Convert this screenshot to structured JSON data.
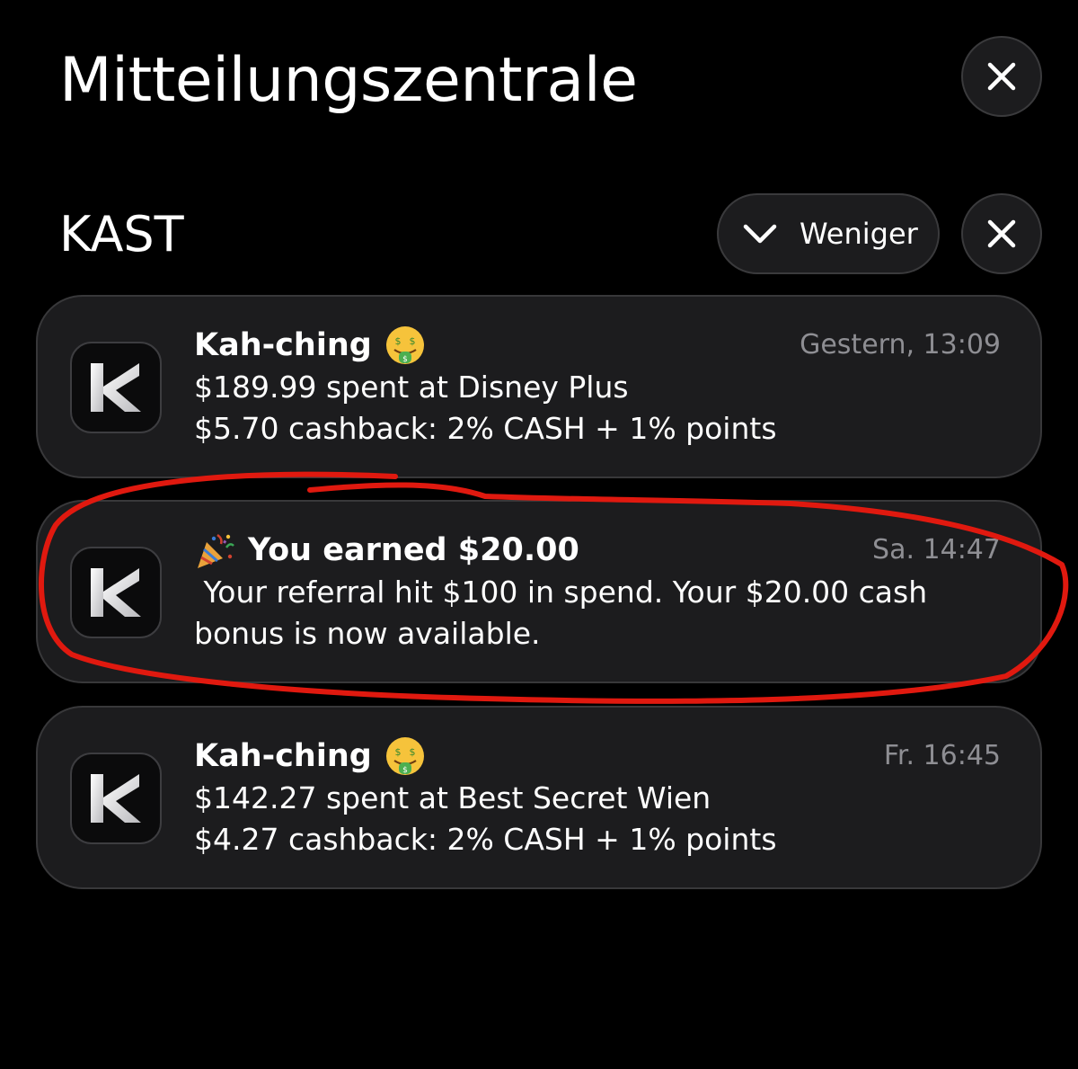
{
  "header": {
    "title": "Mitteilungszentrale"
  },
  "group": {
    "name": "KAST",
    "less_label": "Weniger"
  },
  "notifications": [
    {
      "title": "Kah-ching",
      "emoji": "money-mouth-face-icon",
      "time": "Gestern, 13:09",
      "lines": [
        "$189.99 spent at Disney Plus",
        "$5.70 cashback: 2% CASH + 1% points"
      ]
    },
    {
      "title": "You earned $20.00",
      "emoji": "party-popper-icon",
      "time": "Sa. 14:47",
      "lines": [
        " Your referral hit $100 in spend. Your $20.00 cash",
        "bonus is now available."
      ]
    },
    {
      "title": "Kah-ching",
      "emoji": "money-mouth-face-icon",
      "time": "Fr. 16:45",
      "lines": [
        "$142.27 spent at Best Secret Wien",
        "$4.27 cashback: 2% CASH + 1% points"
      ]
    }
  ],
  "colors": {
    "background": "#000000",
    "card": "#1c1c1e",
    "secondary_text": "#8e8e93",
    "annotation": "#e0190f"
  }
}
